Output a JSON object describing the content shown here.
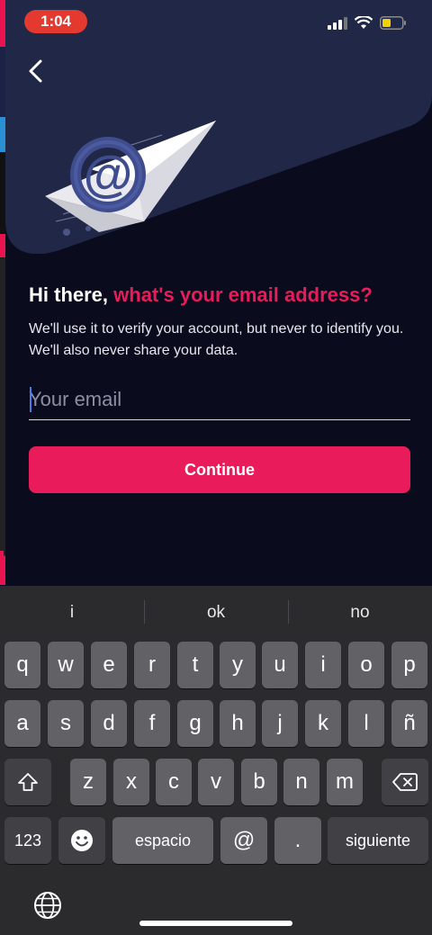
{
  "status_bar": {
    "time": "1:04"
  },
  "header": {
    "back_icon": "chevron-left-icon"
  },
  "illustration": {
    "name": "email-envelope-at-illustration"
  },
  "content": {
    "headline_start": "Hi there, ",
    "headline_accent": "what's your email address?",
    "subtext": "We'll use it to verify your account, but never to identify you. We'll also never share your data.",
    "email_placeholder": "Your email",
    "continue_label": "Continue"
  },
  "colors": {
    "accent": "#ea1b5a",
    "hero": "#212847",
    "background": "#0a0b1d"
  },
  "keyboard": {
    "suggestions": [
      "i",
      "ok",
      "no"
    ],
    "row1": [
      "q",
      "w",
      "e",
      "r",
      "t",
      "y",
      "u",
      "i",
      "o",
      "p"
    ],
    "row2": [
      "a",
      "s",
      "d",
      "f",
      "g",
      "h",
      "j",
      "k",
      "l",
      "ñ"
    ],
    "row3": [
      "z",
      "x",
      "c",
      "v",
      "b",
      "n",
      "m"
    ],
    "numbers_label": "123",
    "space_label": "espacio",
    "at_label": "@",
    "dot_label": ".",
    "next_label": "siguiente"
  }
}
